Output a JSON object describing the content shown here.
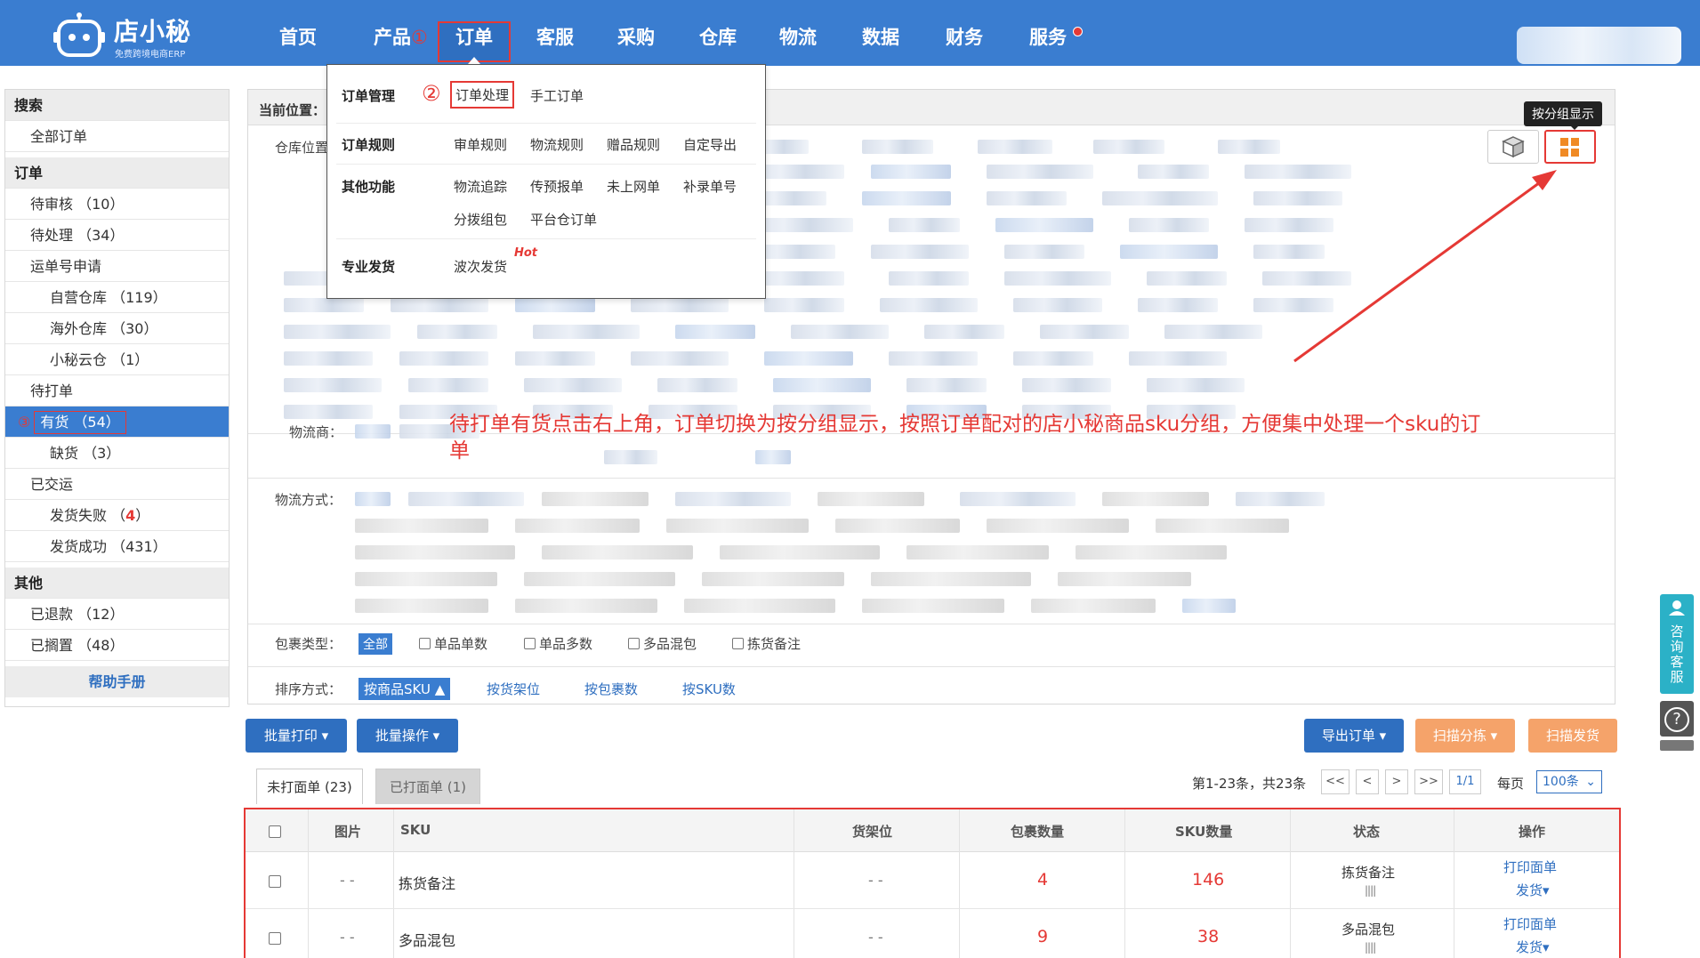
{
  "brand": {
    "name": "店小秘",
    "tagline": "免费跨境电商ERP"
  },
  "nav": {
    "items": [
      "首页",
      "产品",
      "订单",
      "客服",
      "采购",
      "仓库",
      "物流",
      "数据",
      "财务",
      "服务"
    ],
    "marker_1": "①"
  },
  "dropdown": {
    "order_mgmt": {
      "label": "订单管理",
      "marker": "②",
      "process": "订单处理",
      "manual": "手工订单"
    },
    "rules": {
      "label": "订单规则",
      "items": [
        "审单规则",
        "物流规则",
        "赠品规则",
        "自定导出"
      ]
    },
    "other": {
      "label": "其他功能",
      "items": [
        "物流追踪",
        "传预报单",
        "未上网单",
        "补录单号",
        "分拨组包",
        "平台仓订单"
      ]
    },
    "pro_ship": {
      "label": "专业发货",
      "item": "波次发货",
      "hot": "Hot"
    }
  },
  "sidebar": {
    "search_head": "搜索",
    "all_orders": "全部订单",
    "order_head": "订单",
    "pending_review": "待审核 （10）",
    "pending_process": "待处理 （34）",
    "waybill_apply": "运单号申请",
    "self_warehouse": "自营仓库 （119）",
    "overseas_warehouse": "海外仓库 （30）",
    "xiaomi_cloud": "小秘云仓 （1）",
    "to_print": "待打单",
    "marker_3": "③",
    "in_stock": "有货 （54）",
    "out_of_stock": "缺货 （3）",
    "shipped": "已交运",
    "ship_fail_label": "发货失败 （",
    "ship_fail_count": "4",
    "ship_fail_end": "）",
    "ship_success": "发货成功 （431）",
    "other_head": "其他",
    "refunded": "已退款 （12）",
    "shelved": "已搁置 （48）",
    "help": "帮助手册"
  },
  "filters": {
    "location_label": "当前位置：",
    "warehouse_label": "仓库位置",
    "carrier_label": "物流商：",
    "method_label": "物流方式：",
    "package_type_label": "包裹类型：",
    "package_all": "全部",
    "package_options": [
      "单品单数",
      "单品多数",
      "多品混包",
      "拣货备注"
    ],
    "sort_label": "排序方式：",
    "sort_active": "按商品SKU ▲",
    "sort_options": [
      "按货架位",
      "按包裹数",
      "按SKU数"
    ]
  },
  "view_toggle": {
    "tooltip": "按分组显示"
  },
  "annotation": "待打单有货点击右上角，订单切换为按分组显示，按照订单配对的店小秘商品sku分组，方便集中处理一个sku的订单",
  "toolbar": {
    "batch_print": "批量打印 ▾",
    "batch_ops": "批量操作 ▾",
    "export": "导出订单 ▾",
    "scan_sort": "扫描分拣 ▾",
    "scan_ship": "扫描发货"
  },
  "tabs": {
    "unprinted": "未打面单 (23)",
    "printed": "已打面单 (1)"
  },
  "pagination": {
    "summary": "第1-23条，共23条",
    "first": "<<",
    "prev": "<",
    "next": ">",
    "last": ">>",
    "page": "1/1",
    "per_page_label": "每页",
    "per_page": "100条"
  },
  "table": {
    "headers": {
      "image": "图片",
      "sku": "SKU",
      "shelf": "货架位",
      "packages": "包裹数量",
      "sku_count": "SKU数量",
      "status": "状态",
      "actions": "操作"
    },
    "rows": [
      {
        "image": "- -",
        "sku": "拣货备注",
        "shelf": "- -",
        "packages": "4",
        "sku_count": "146",
        "status": "拣货备注",
        "print": "打印面单",
        "ship": "发货▾"
      },
      {
        "image": "- -",
        "sku": "多品混包",
        "shelf": "- -",
        "packages": "9",
        "sku_count": "38",
        "status": "多品混包",
        "print": "打印面单",
        "ship": "发货▾"
      }
    ]
  },
  "float": {
    "service": "咨询客服",
    "help": "?"
  },
  "colors": {
    "primary": "#3a7dd0",
    "highlight": "#e53935",
    "orange": "#f5a36a",
    "service": "#2bb1c7"
  }
}
